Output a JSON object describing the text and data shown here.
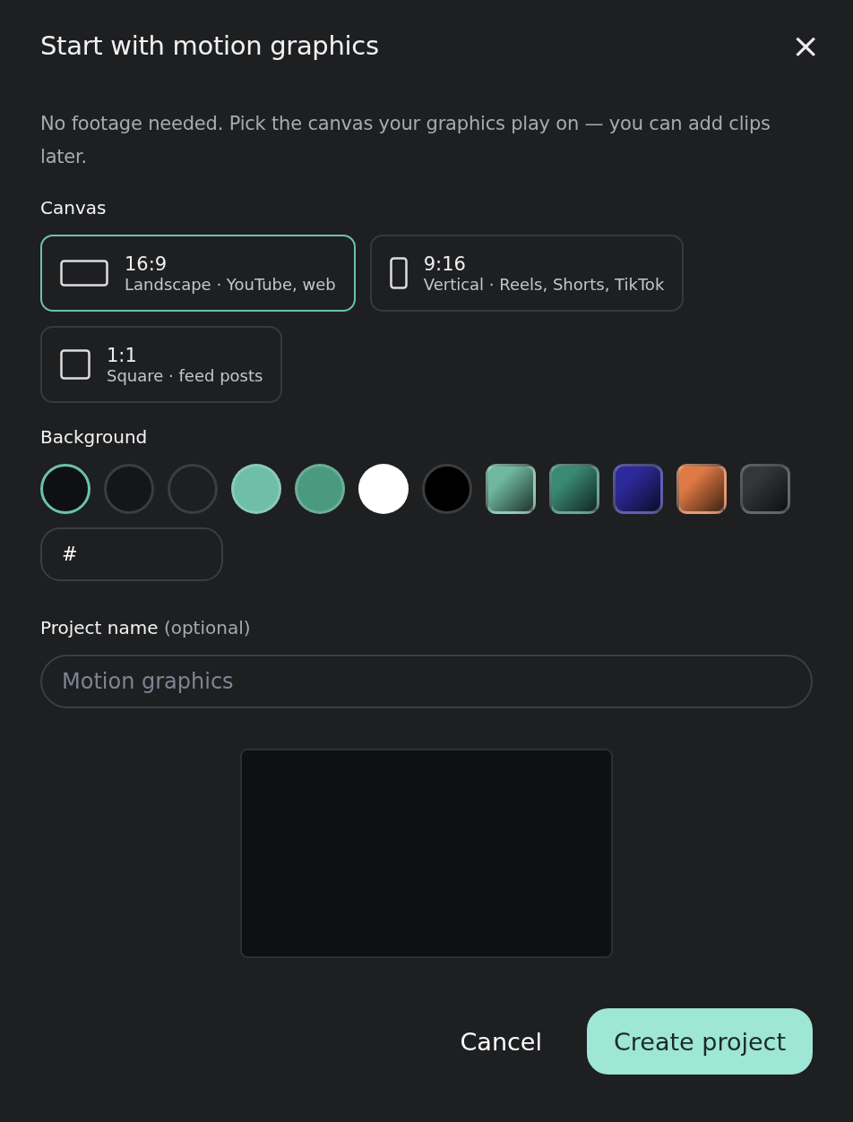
{
  "dialog": {
    "title": "Start with motion graphics",
    "close": "×",
    "description": "No footage needed. Pick the canvas your graphics play on — you can add clips later."
  },
  "canvas": {
    "label": "Canvas",
    "options": [
      {
        "kind": "landscape",
        "ratio": "16:9",
        "caption": "Landscape · YouTube, web",
        "selected": true
      },
      {
        "kind": "portrait",
        "ratio": "9:16",
        "caption": "Vertical · Reels, Shorts, TikTok",
        "selected": false
      },
      {
        "kind": "square",
        "ratio": "1:1",
        "caption": "Square · feed posts",
        "selected": false
      }
    ]
  },
  "background": {
    "label": "Background",
    "swatches": [
      {
        "kind": "solid",
        "color": "#0f1012",
        "selected": true
      },
      {
        "kind": "solid",
        "color": "#151618",
        "selected": false
      },
      {
        "kind": "solid",
        "color": "#1e1f21",
        "selected": false
      },
      {
        "kind": "solid",
        "color": "#6fbfa6",
        "selected": false
      },
      {
        "kind": "solid",
        "color": "#4a9a80",
        "selected": false
      },
      {
        "kind": "solid",
        "color": "#ffffff",
        "selected": false
      },
      {
        "kind": "solid",
        "color": "#000000",
        "selected": false
      },
      {
        "kind": "gradient",
        "color": "#6fb8a0",
        "selected": false
      },
      {
        "kind": "gradient",
        "color": "#3a8a72",
        "selected": false
      },
      {
        "kind": "gradient",
        "color": "#2c2a9a",
        "selected": false
      },
      {
        "kind": "gradient",
        "color": "#e07a45",
        "selected": false
      },
      {
        "kind": "gradient",
        "color": "#34363a",
        "selected": false
      }
    ],
    "hex_value": "#"
  },
  "project_name": {
    "label": "Project name",
    "hint": "(optional)",
    "placeholder": "Motion graphics"
  },
  "buttons": [
    {
      "kind": "secondary",
      "label": "Cancel"
    },
    {
      "kind": "primary",
      "label": "Create project"
    }
  ]
}
